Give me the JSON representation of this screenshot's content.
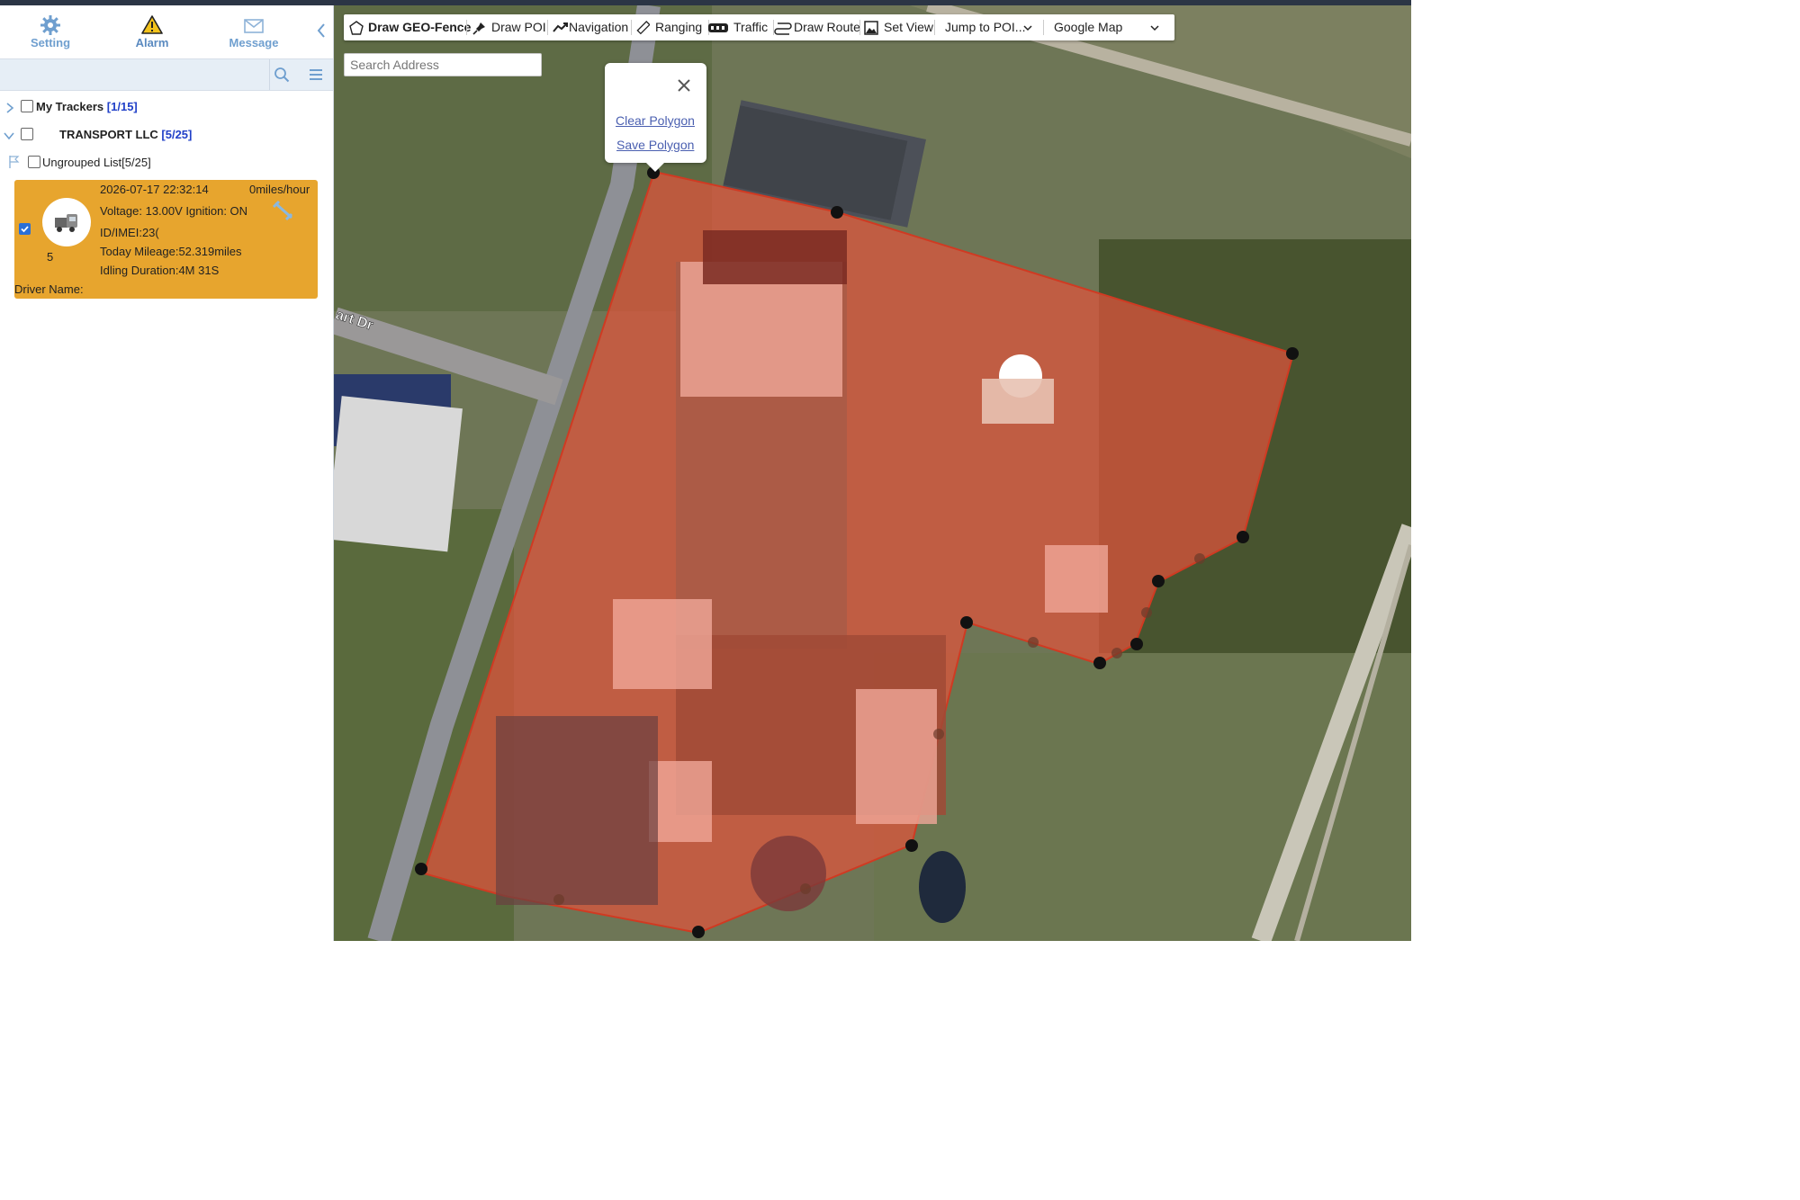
{
  "nav": {
    "setting_label": "Setting",
    "alarm_label": "Alarm",
    "message_label": "Message"
  },
  "sidebar_search": {
    "placeholder": ""
  },
  "tree": {
    "my_trackers": {
      "label": "My Trackers",
      "count": "[1/15]"
    },
    "company": {
      "label": "TRANSPORT LLC",
      "count": "[5/25]"
    },
    "ungrouped": {
      "label": "Ungrouped List[5/25]"
    }
  },
  "tracker": {
    "timestamp": "2026-07-17 22:32:14",
    "speed": "0miles/hour",
    "voltage_ignition": "Voltage: 13.00V  Ignition: ON",
    "id_imei": "ID/IMEI:23(",
    "number": "5",
    "mileage": "Today Mileage:52.319miles",
    "idling": "Idling Duration:4M 31S",
    "driver": "Driver Name:"
  },
  "toolbar": {
    "draw_geofence": "Draw GEO-Fence",
    "draw_poi": "Draw POI",
    "navigation": "Navigation",
    "ranging": "Ranging",
    "traffic": "Traffic",
    "draw_route": "Draw Route",
    "set_view": "Set View",
    "jump_to_poi": "Jump to POI...",
    "map_type": "Google Map"
  },
  "map_search": {
    "placeholder": "Search Address"
  },
  "popup": {
    "clear_label": "Clear Polygon",
    "save_label": "Save Polygon"
  },
  "map_labels": {
    "street": "art Dr"
  },
  "colors": {
    "accent_blue": "#6f9fcf",
    "tracker_card": "#e7a52e",
    "geofence_fill": "#e0533c",
    "count_blue": "#2140c8"
  }
}
